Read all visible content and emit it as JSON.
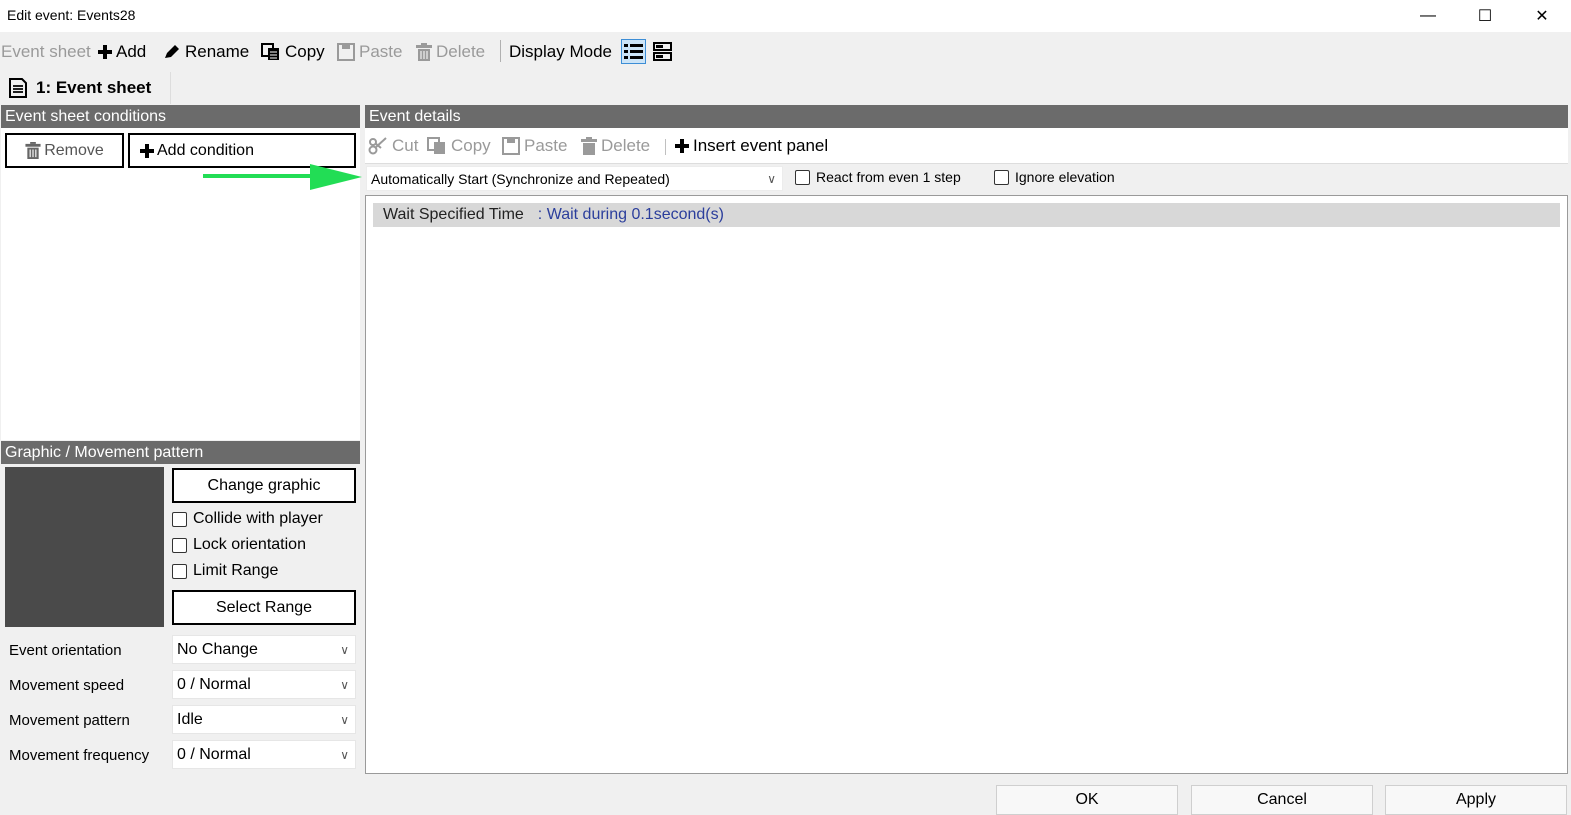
{
  "window": {
    "title": "Edit event: Events28",
    "minimize_symbol": "—",
    "maximize_symbol": "☐",
    "close_symbol": "✕"
  },
  "toolbar": {
    "event_sheet_label": "Event sheet",
    "add_label": "Add",
    "rename_label": "Rename",
    "copy_label": "Copy",
    "paste_label": "Paste",
    "delete_label": "Delete",
    "display_mode_label": "Display Mode"
  },
  "tabs": [
    {
      "label": "1: Event sheet"
    }
  ],
  "conditions_panel": {
    "header": "Event sheet conditions",
    "remove_label": "Remove",
    "add_condition_label": "Add condition"
  },
  "graphic_panel": {
    "header": "Graphic / Movement pattern",
    "change_graphic_label": "Change graphic",
    "collide_label": "Collide with player",
    "lock_orientation_label": "Lock orientation",
    "limit_range_label": "Limit Range",
    "select_range_label": "Select Range",
    "fields": [
      {
        "label": "Event orientation",
        "value": "No Change"
      },
      {
        "label": "Movement speed",
        "value": "0 / Normal"
      },
      {
        "label": "Movement pattern",
        "value": "Idle"
      },
      {
        "label": "Movement frequency",
        "value": "0 / Normal"
      }
    ]
  },
  "details_panel": {
    "header": "Event details",
    "cut_label": "Cut",
    "copy_label": "Copy",
    "paste_label": "Paste",
    "delete_label": "Delete",
    "insert_label": "Insert event panel",
    "trigger_value": "Automatically Start (Synchronize and Repeated)",
    "react_label": "React from even 1 step",
    "ignore_elevation_label": "Ignore elevation",
    "commands": [
      {
        "name": "Wait Specified Time",
        "detail": ": Wait during 0.1second(s)"
      }
    ]
  },
  "footer": {
    "ok_label": "OK",
    "cancel_label": "Cancel",
    "apply_label": "Apply"
  },
  "colors": {
    "panel_header": "#6b6b6b",
    "command_detail": "#2b3e9c",
    "annotation_arrow": "#22dd55",
    "preview_bg": "#4a4a4a"
  }
}
